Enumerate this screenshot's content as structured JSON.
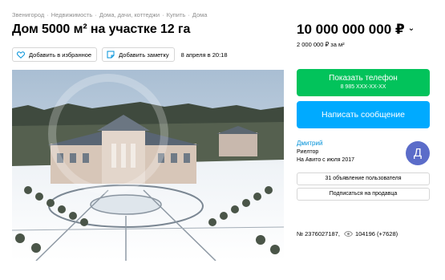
{
  "breadcrumb": {
    "items": [
      "Звенигород",
      "Недвижимость",
      "Дома, дачи, коттеджи",
      "Купить",
      "Дома"
    ],
    "separator": "·"
  },
  "listing": {
    "title": "Дом 5000 м² на участке 12 га",
    "favorite_label": "Добавить в избранное",
    "note_label": "Добавить заметку",
    "date": "8 апреля в 20:18",
    "price": "10 000 000 000 ₽",
    "price_per_m2": "2 000 000 ₽ за м²",
    "number_text": "№ 2376027187,",
    "views_text": "104196 (+7628)"
  },
  "contact": {
    "phone_label": "Показать телефон",
    "phone_masked": "8 985 XXX-XX-XX",
    "message_label": "Написать сообщение"
  },
  "seller": {
    "name": "Дмитрий",
    "role": "Риелтор",
    "since": "На Авито с июля 2017",
    "avatar_letter": "Д",
    "ads_label": "31 объявление пользователя",
    "subscribe_label": "Подписаться на продавца"
  },
  "colors": {
    "green": "#02c35b",
    "blue": "#00aaff",
    "link": "#0091d9",
    "avatar": "#5b6cc9"
  },
  "icons": {
    "favorite": "heart-icon",
    "note": "note-icon",
    "price_menu": "chevron-down-icon",
    "views": "eye-icon"
  }
}
